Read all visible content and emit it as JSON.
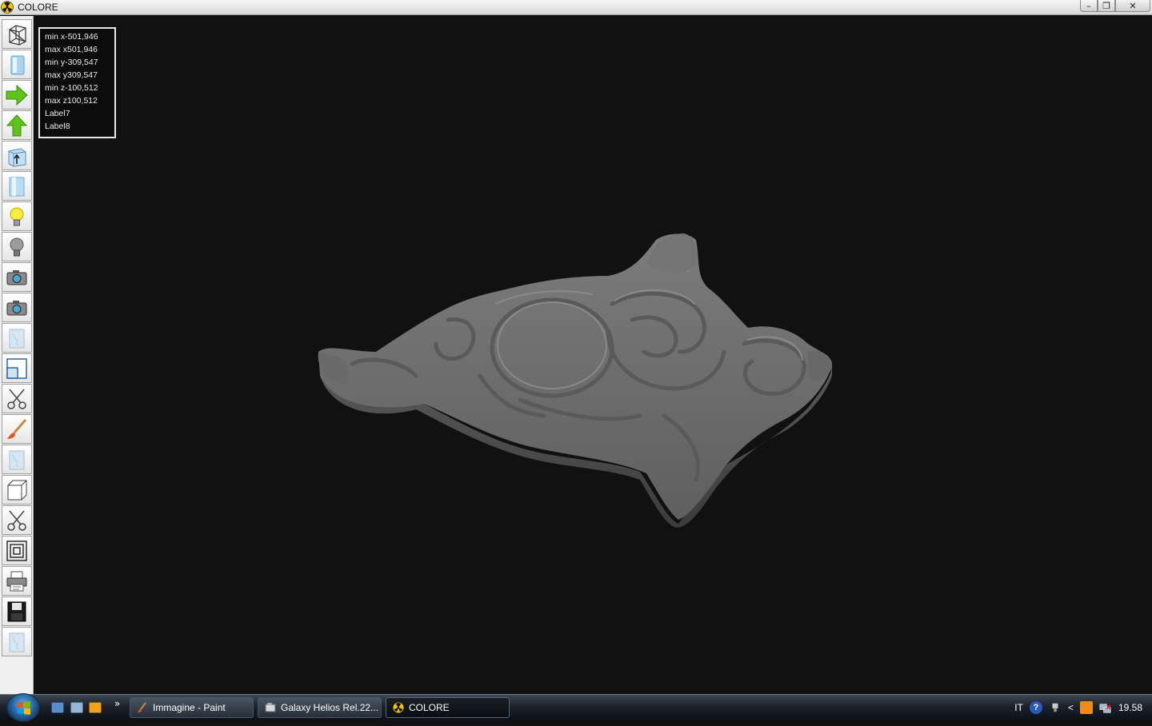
{
  "window": {
    "title": "COLORE",
    "controls": {
      "minimize": "–",
      "maximize": "❐",
      "close": "✕"
    }
  },
  "toolbar": {
    "items": [
      {
        "name": "wireframe-box-icon"
      },
      {
        "name": "solid-box-icon"
      },
      {
        "name": "arrow-right-icon"
      },
      {
        "name": "arrow-up-icon"
      },
      {
        "name": "box-arrow-icon"
      },
      {
        "name": "cylinder-icon"
      },
      {
        "name": "lightbulb-on-icon"
      },
      {
        "name": "lightbulb-off-icon"
      },
      {
        "name": "camera-icon"
      },
      {
        "name": "camera-alt-icon"
      },
      {
        "name": "texture-icon"
      },
      {
        "name": "window-icon"
      },
      {
        "name": "scissors-icon"
      },
      {
        "name": "paintbrush-icon"
      },
      {
        "name": "texture-alt-icon"
      },
      {
        "name": "cube-icon"
      },
      {
        "name": "scissors-alt-icon"
      },
      {
        "name": "nested-squares-icon"
      },
      {
        "name": "printer-icon"
      },
      {
        "name": "floppy-disk-icon"
      },
      {
        "name": "texture-third-icon"
      }
    ]
  },
  "info": {
    "min_x": "min x-501,946",
    "max_x": "max x501,946",
    "min_y": "min y-309,547",
    "max_y": "max y309,547",
    "min_z": "min z-100,512",
    "max_z": "max z100,512",
    "label7": "Label7",
    "label8": "Label8"
  },
  "taskbar": {
    "overflow": "»",
    "tasks": [
      {
        "label": "Immagine - Paint"
      },
      {
        "label": "Galaxy Helios  Rel.22..."
      },
      {
        "label": "COLORE"
      }
    ],
    "tray": {
      "language": "IT",
      "help": "?",
      "chevron": "<",
      "clock": "19.58"
    }
  },
  "colors": {
    "viewport_bg": "#111111",
    "model_gray": "#707070",
    "arrow_green": "#5ec41a"
  }
}
